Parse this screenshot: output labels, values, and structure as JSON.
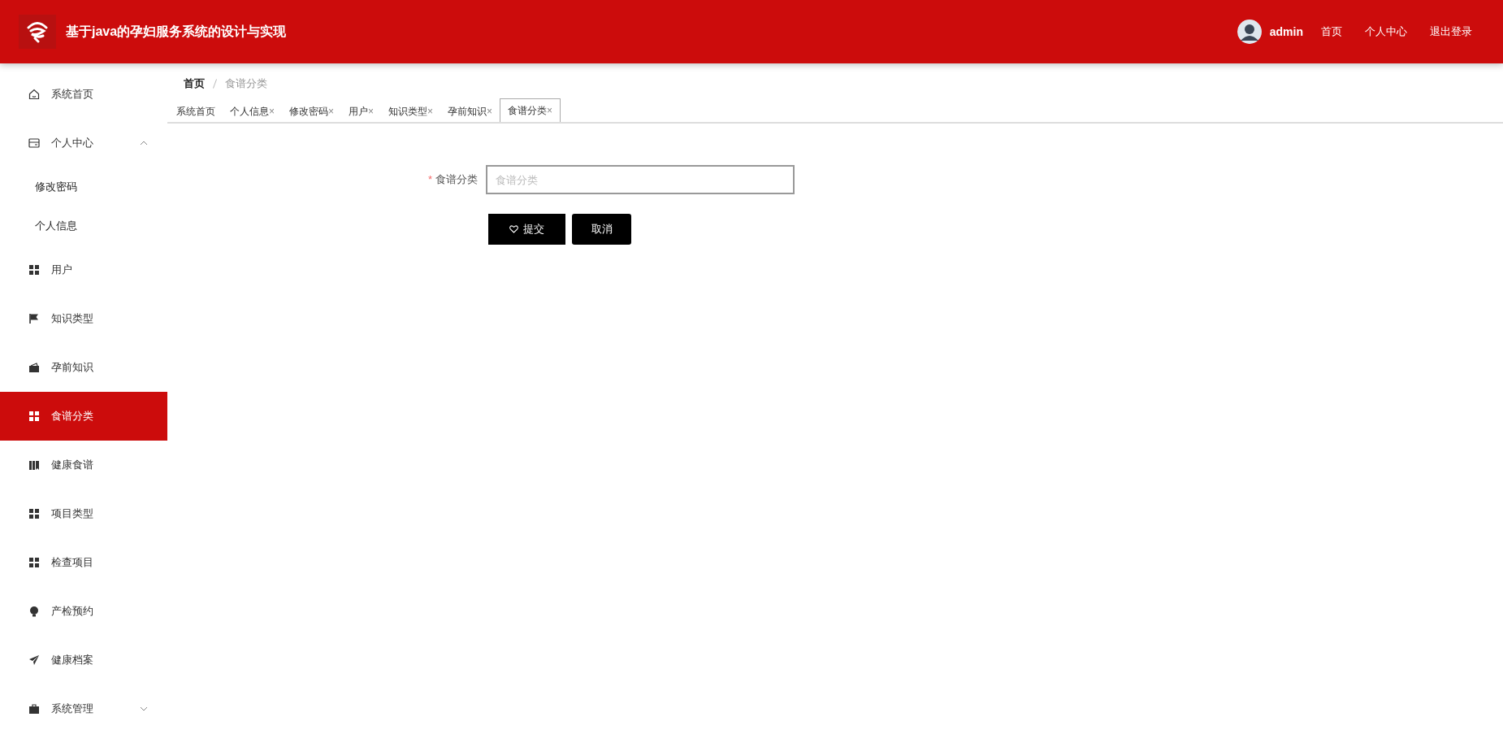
{
  "header": {
    "title": "基于java的孕妇服务系统的设计与实现",
    "user": {
      "name": "admin"
    },
    "links": [
      "首页",
      "个人中心",
      "退出登录"
    ]
  },
  "sidebar": {
    "items": [
      {
        "label": "系统首页",
        "selected": false
      },
      {
        "label": "个人中心",
        "selected": false,
        "expanded": true,
        "children": [
          {
            "label": "修改密码",
            "selected": false
          },
          {
            "label": "个人信息",
            "selected": false
          }
        ]
      },
      {
        "label": "用户",
        "selected": false
      },
      {
        "label": "知识类型",
        "selected": false
      },
      {
        "label": "孕前知识",
        "selected": false
      },
      {
        "label": "食谱分类",
        "selected": true
      },
      {
        "label": "健康食谱",
        "selected": false
      },
      {
        "label": "项目类型",
        "selected": false
      },
      {
        "label": "检查项目",
        "selected": false
      },
      {
        "label": "产检预约",
        "selected": false
      },
      {
        "label": "健康档案",
        "selected": false
      },
      {
        "label": "系统管理",
        "selected": false,
        "expanded": false
      }
    ]
  },
  "breadcrumb": [
    "首页",
    "食谱分类"
  ],
  "tabs": [
    {
      "label": "系统首页",
      "closable": false,
      "selected": false
    },
    {
      "label": "个人信息",
      "closable": true,
      "selected": false
    },
    {
      "label": "修改密码",
      "closable": true,
      "selected": false
    },
    {
      "label": "用户",
      "closable": true,
      "selected": false
    },
    {
      "label": "知识类型",
      "closable": true,
      "selected": false
    },
    {
      "label": "孕前知识",
      "closable": true,
      "selected": false
    },
    {
      "label": "食谱分类",
      "closable": true,
      "selected": true
    }
  ],
  "close_mark": "×",
  "required_mark": "*",
  "form": {
    "fields": [
      {
        "label": "食谱分类",
        "required": true,
        "placeholder": "食谱分类"
      }
    ],
    "buttons": [
      {
        "label": "提交",
        "kind": "submit"
      },
      {
        "label": "取消",
        "kind": "cancel"
      }
    ]
  }
}
